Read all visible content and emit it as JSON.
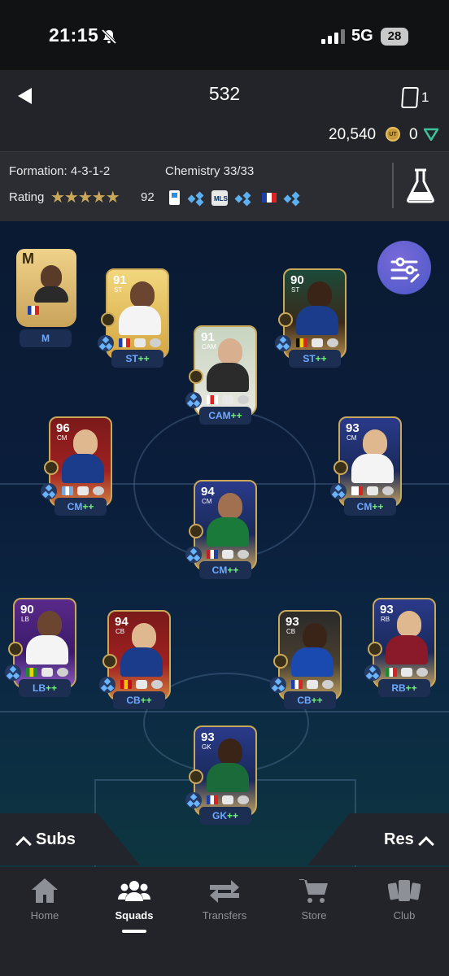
{
  "status_bar": {
    "time": "21:15",
    "network": "5G",
    "battery": "28"
  },
  "header": {
    "title": "532",
    "card_count": "1",
    "coins": "20,540",
    "points": "0"
  },
  "info": {
    "formation": "Formation: 4-3-1-2",
    "chemistry": "Chemistry 33/33",
    "rating_label": "Rating",
    "stars": "★★★★★",
    "rating": "92"
  },
  "manager": {
    "letter": "M",
    "label": "M"
  },
  "players": [
    {
      "rating": "91",
      "pos": "ST",
      "label": "ST",
      "plus": "++"
    },
    {
      "rating": "90",
      "pos": "ST",
      "label": "ST",
      "plus": "++"
    },
    {
      "rating": "91",
      "pos": "CAM",
      "label": "CAM",
      "plus": "++"
    },
    {
      "rating": "96",
      "pos": "CM",
      "label": "CM",
      "plus": "++"
    },
    {
      "rating": "93",
      "pos": "CM",
      "label": "CM",
      "plus": "++"
    },
    {
      "rating": "94",
      "pos": "CM",
      "label": "CM",
      "plus": "++"
    },
    {
      "rating": "90",
      "pos": "LB",
      "label": "LB",
      "plus": "++"
    },
    {
      "rating": "94",
      "pos": "CB",
      "label": "CB",
      "plus": "++"
    },
    {
      "rating": "93",
      "pos": "CB",
      "label": "CB",
      "plus": "++"
    },
    {
      "rating": "93",
      "pos": "RB",
      "label": "RB",
      "plus": "++"
    },
    {
      "rating": "93",
      "pos": "GK",
      "label": "GK",
      "plus": "++"
    }
  ],
  "bottom": {
    "subs": "Subs",
    "res": "Res"
  },
  "nav": [
    {
      "label": "Home"
    },
    {
      "label": "Squads"
    },
    {
      "label": "Transfers"
    },
    {
      "label": "Store"
    },
    {
      "label": "Club"
    }
  ],
  "icons": [
    "back-icon",
    "card-count-icon",
    "coin-icon",
    "points-icon",
    "lab-icon",
    "filter-icon",
    "home-icon",
    "squads-icon",
    "transfers-icon",
    "store-icon",
    "club-icon"
  ],
  "colors": {
    "accent": "#6ea9ff",
    "plus": "#6ff07a",
    "gold": "#c9a85a"
  }
}
